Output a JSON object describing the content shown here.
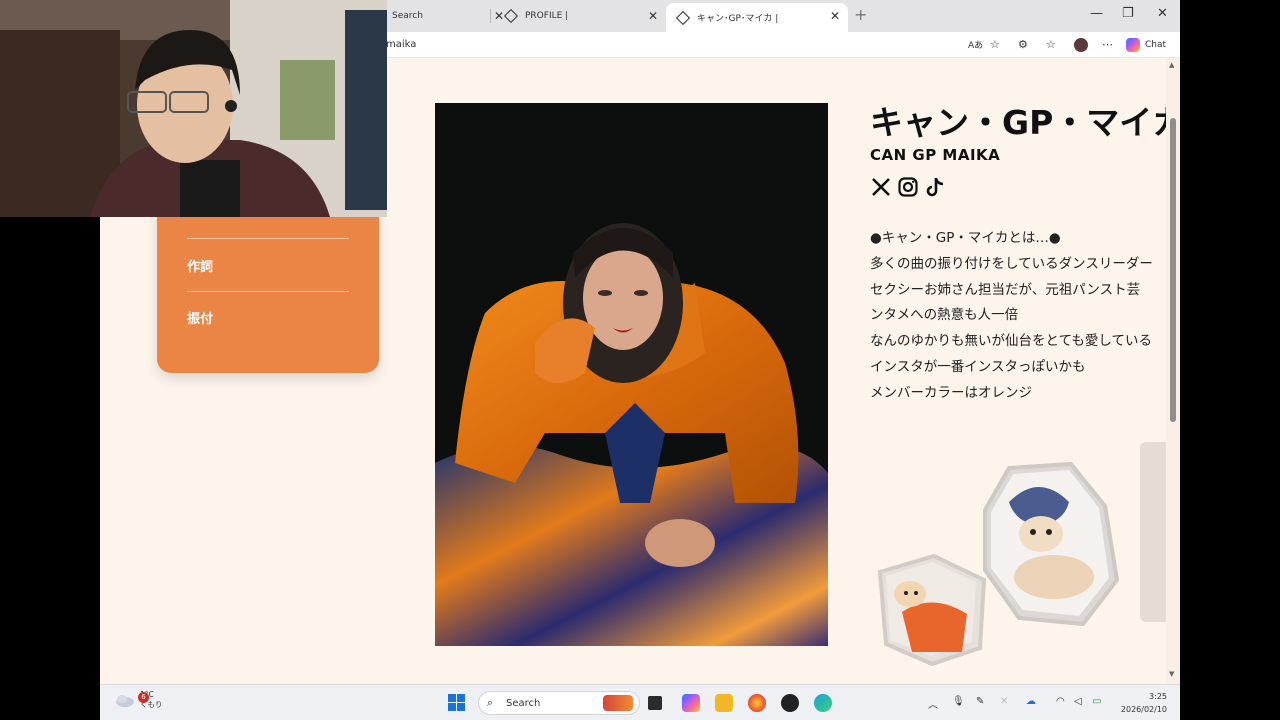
{
  "browser": {
    "tabs": [
      {
        "label": "Search"
      },
      {
        "label": "PROFILE |"
      },
      {
        "label": "キャン･GP･マイカ |"
      }
    ],
    "url": "maika",
    "chat_label": "Chat"
  },
  "sidebar": {
    "items": [
      {
        "label": "作詞"
      },
      {
        "label": "振付"
      }
    ]
  },
  "profile": {
    "name_jp": "キャン・GP・マイカ",
    "name_en": "CAN GP MAIKA",
    "bio": [
      "●キャン・GP・マイカとは…●",
      "多くの曲の振り付けをしているダンスリーダー",
      "セクシーお姉さん担当だが、元祖パンスト芸",
      "ンタメへの熱意も人一倍",
      "なんのゆかりも無いが仙台をとても愛している",
      "インスタが一番インスタっぽいかも",
      "メンバーカラーはオレンジ"
    ]
  },
  "taskbar": {
    "weather_temp": "1°C",
    "weather_desc": "くもり",
    "weather_badge": "6",
    "search_label": "Search",
    "time": "3:25",
    "date": "2026/02/10"
  },
  "colors": {
    "page_bg": "#fdf4ec",
    "accent_orange": "#ea8545",
    "text": "#111111"
  }
}
